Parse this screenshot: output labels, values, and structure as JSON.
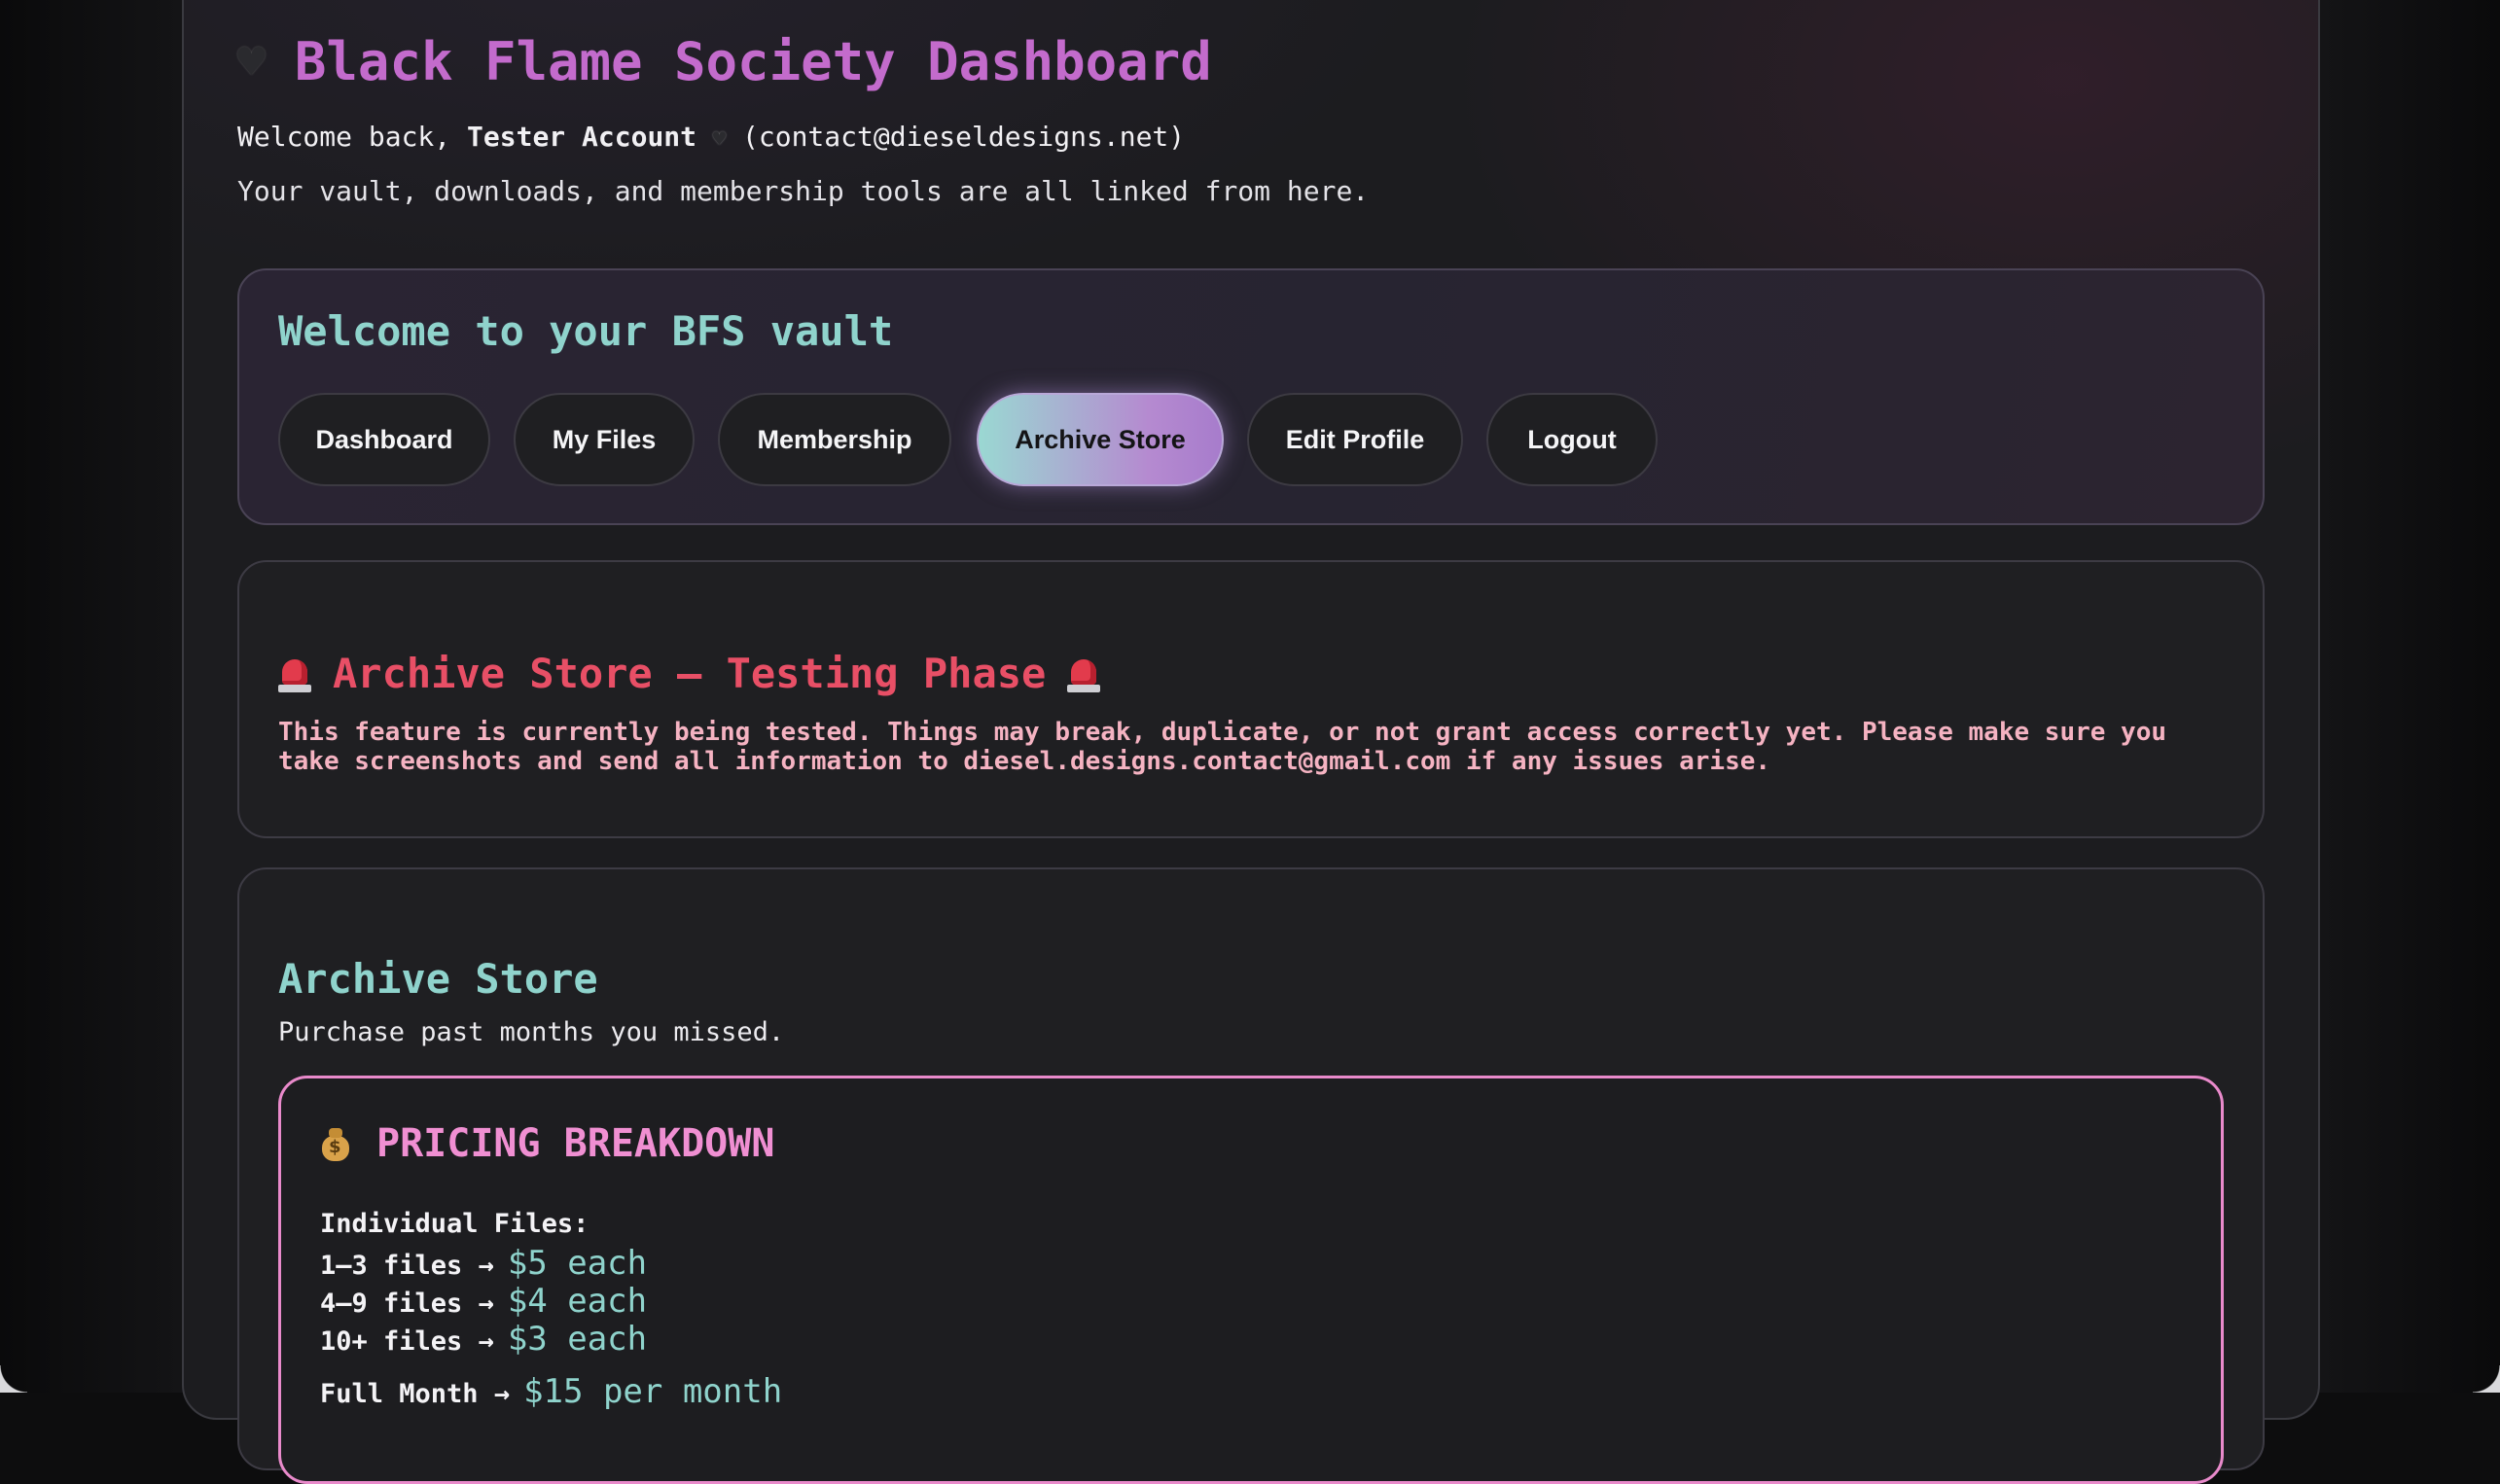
{
  "header": {
    "icon": "black-heart-icon",
    "title": "Black Flame Society Dashboard",
    "welcome_prefix": "Welcome back,",
    "user_name": "Tester Account",
    "user_email": "(contact@dieseldesigns.net)",
    "subtitle": "Your vault, downloads, and membership tools are all linked from here."
  },
  "nav": {
    "heading": "Welcome to your BFS vault",
    "items": [
      {
        "label": "Dashboard",
        "active": false
      },
      {
        "label": "My Files",
        "active": false
      },
      {
        "label": "Membership",
        "active": false
      },
      {
        "label": "Archive Store",
        "active": true
      },
      {
        "label": "Edit Profile",
        "active": false
      },
      {
        "label": "Logout",
        "active": false
      }
    ]
  },
  "warning": {
    "icon": "siren-icon",
    "title": "Archive Store — Testing Phase",
    "line1": "This feature is currently being tested. Things may break, duplicate, or not grant access correctly yet. Please make sure you",
    "line2": "take screenshots and send all information to diesel.designs.contact@gmail.com if any issues arise."
  },
  "store": {
    "title": "Archive Store",
    "subtitle": "Purchase past months you missed.",
    "pricing": {
      "icon": "money-bag-icon",
      "title": "PRICING BREAKDOWN",
      "individual_label": "Individual Files:",
      "tiers": [
        {
          "range": "1–3 files →",
          "price": "$5 each"
        },
        {
          "range": "4–9 files →",
          "price": "$4 each"
        },
        {
          "range": "10+ files →",
          "price": "$3 each"
        }
      ],
      "full_month_label": "Full Month →",
      "full_month_price": "$15 per month"
    }
  },
  "colors": {
    "title_accent": "#c36bcc",
    "teal_accent": "#8fd3cc",
    "warning_red": "#e84f66",
    "warning_text": "#f5b3c2",
    "pricing_border": "#e98acb"
  }
}
